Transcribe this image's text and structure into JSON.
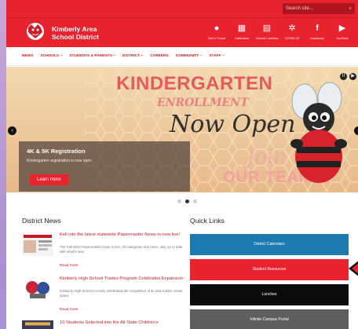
{
  "search": {
    "placeholder": "Search site...",
    "icon": "search-icon"
  },
  "brand": {
    "line1": "Kimberly Area",
    "line2": "School District"
  },
  "quick_icons": [
    {
      "icon": "chat-icon",
      "label": "Get in Touch"
    },
    {
      "icon": "calendar-icon",
      "label": "Calendars"
    },
    {
      "icon": "news-icon",
      "label": "School Lunches"
    },
    {
      "icon": "virus-icon",
      "label": "COVID-19"
    },
    {
      "icon": "facebook-icon",
      "label": "Facebook"
    },
    {
      "icon": "youtube-icon",
      "label": "YouTube"
    }
  ],
  "nav": [
    "News",
    "Schools ~",
    "Students & Parents ~",
    "District ~",
    "Careers",
    "Community ~",
    "Staff ~"
  ],
  "hero": {
    "kindergarten": "KINDERGARTEN",
    "enrollment": "ENROLLMENT",
    "now_open": "Now Open",
    "join": "Join",
    "our_team": "OUR TEAM!",
    "caption_title": "4K & 5K Registration",
    "caption_sub": "Kindergarten registration is now open",
    "learn_more": "Learn more",
    "pause": "II",
    "prev": "‹",
    "next": "›"
  },
  "district_news": {
    "title": "District News",
    "items": [
      {
        "headline": "Kell into the latest statewide Papermaster News in now live!",
        "body": "The Fall 2022 Papermaster issue is live. All categories and more, stay up to date with what's new.",
        "read_more": "Read more"
      },
      {
        "headline": "Kimberly High School Trades Program Celebrates Expansion",
        "body": "Kimberly High School recently celebrated the completion of its new trades center space.",
        "read_more": "Read more"
      },
      {
        "headline": "10 Students Selected into the All State Children's"
      }
    ]
  },
  "quick_links": {
    "title": "Quick Links",
    "items": [
      {
        "label": "District Calendars",
        "color": "#1b7bb0"
      },
      {
        "label": "Student Resources",
        "color": "#e8232e"
      },
      {
        "label": "Lunches",
        "color": "#0b0b0b"
      },
      {
        "label": "Infinite Campus Portal",
        "color": "#5e5e5e"
      }
    ]
  },
  "colors": {
    "brand_red": "#e8232e",
    "dark_red": "#c81b25"
  }
}
